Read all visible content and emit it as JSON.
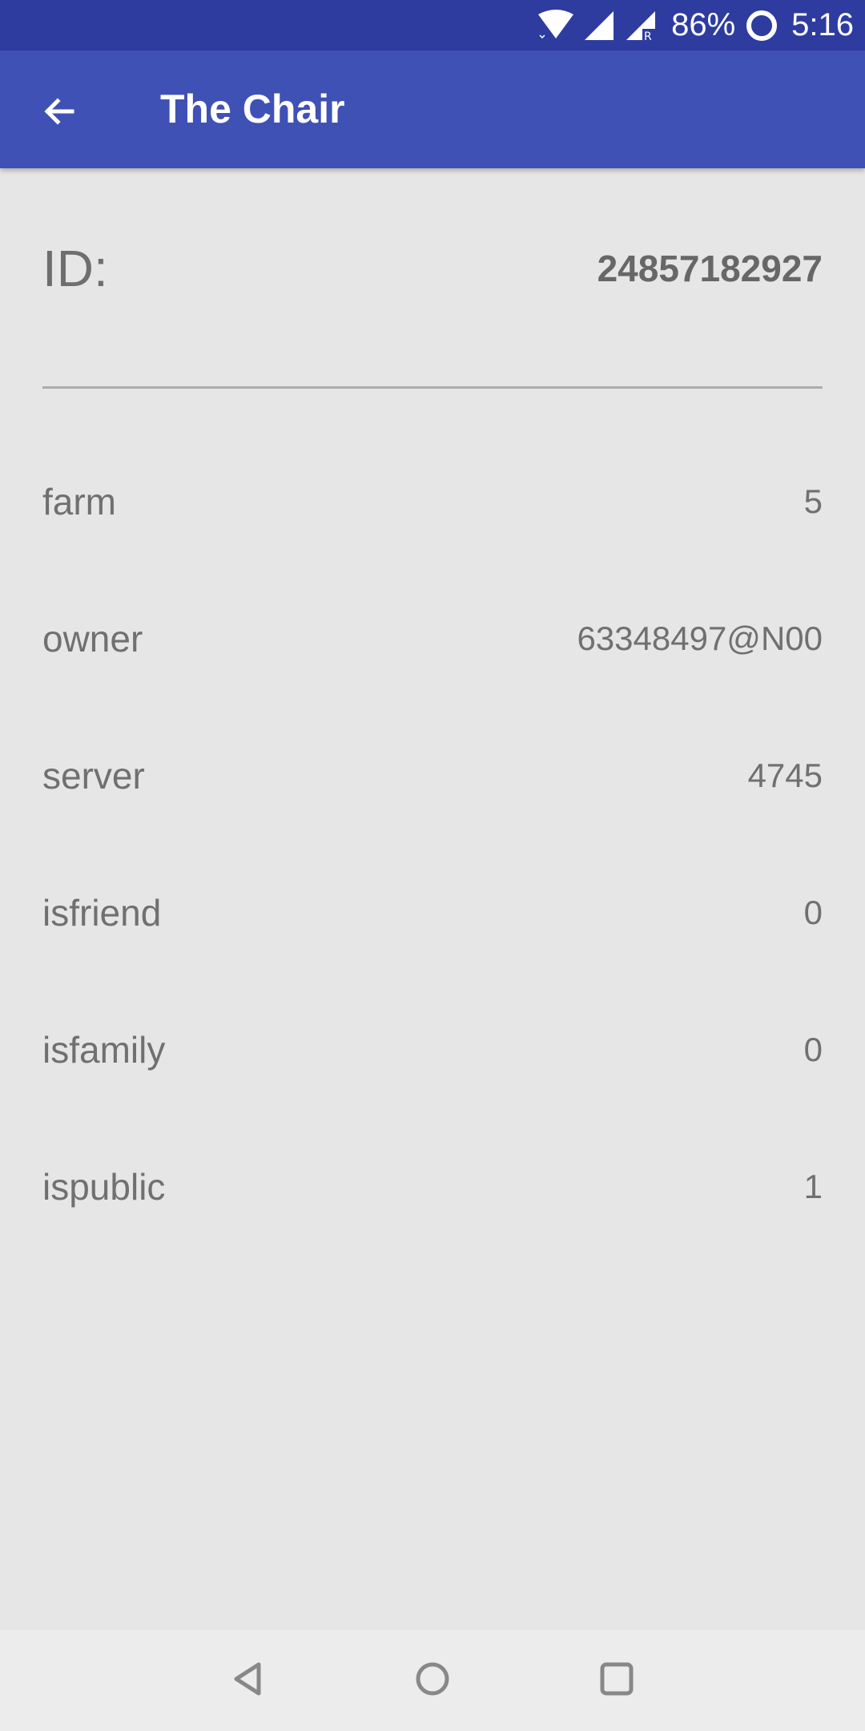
{
  "status_bar": {
    "battery": "86%",
    "time": "5:16",
    "icons": [
      "wifi-icon",
      "signal-icon",
      "roaming-signal-icon",
      "battery-icon"
    ]
  },
  "app_bar": {
    "title": "The Chair",
    "back_icon": "arrow-back-icon",
    "background_color": "#3f51b5"
  },
  "details": {
    "id_label": "ID:",
    "id_value": "24857182927",
    "rows": [
      {
        "key": "farm",
        "value": "5"
      },
      {
        "key": "owner",
        "value": "63348497@N00"
      },
      {
        "key": "server",
        "value": "4745"
      },
      {
        "key": "isfriend",
        "value": "0"
      },
      {
        "key": "isfamily",
        "value": "0"
      },
      {
        "key": "ispublic",
        "value": "1"
      }
    ]
  },
  "nav_bar": {
    "icons": [
      "back-triangle-icon",
      "home-circle-icon",
      "recents-square-icon"
    ]
  }
}
